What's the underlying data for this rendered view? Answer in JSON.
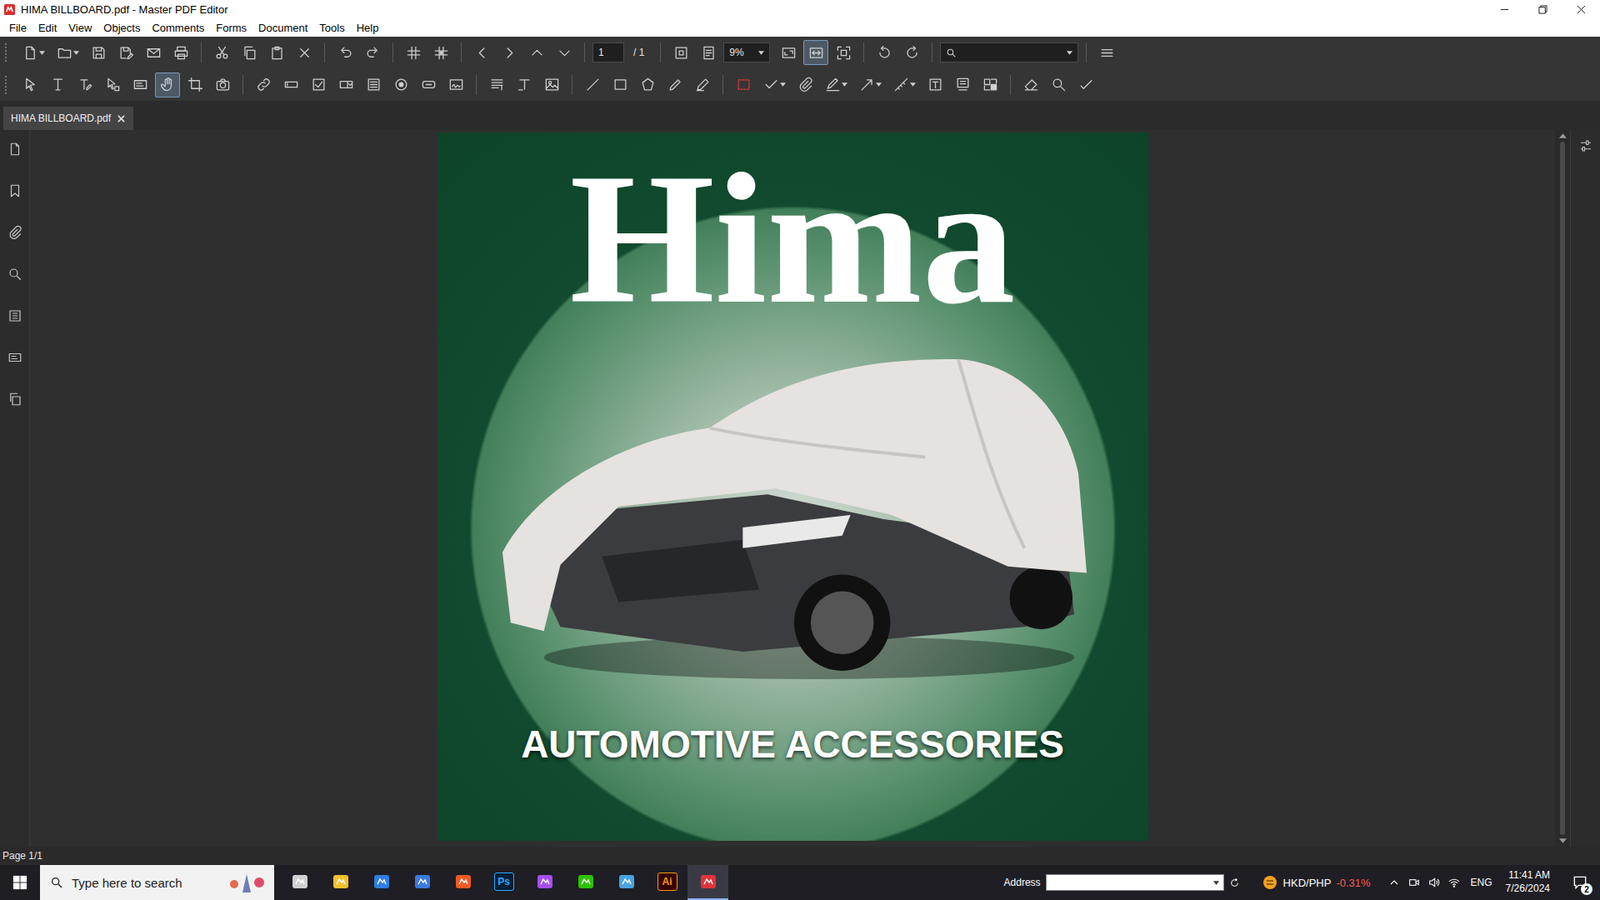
{
  "window": {
    "title": "HIMA BILLBOARD.pdf - Master PDF Editor"
  },
  "menu": [
    "File",
    "Edit",
    "View",
    "Objects",
    "Comments",
    "Forms",
    "Document",
    "Tools",
    "Help"
  ],
  "main_toolbar": {
    "groups": [
      {
        "buttons": [
          {
            "selected": false,
            "dropdown": true
          },
          {
            "selected": false,
            "dropdown": true
          },
          {
            "selected": false,
            "dropdown": false
          },
          {
            "selected": false,
            "dropdown": false
          },
          {
            "selected": false,
            "dropdown": false
          },
          {
            "selected": false,
            "dropdown": false
          }
        ]
      },
      {
        "buttons": [
          {
            "selected": false,
            "dropdown": false
          },
          {
            "selected": false,
            "dropdown": false
          },
          {
            "selected": false,
            "dropdown": false
          },
          {
            "selected": false,
            "dropdown": false
          }
        ]
      },
      {
        "buttons": [
          {
            "selected": false,
            "dropdown": false
          },
          {
            "selected": false,
            "dropdown": false
          }
        ]
      },
      {
        "buttons": [
          {
            "selected": false,
            "dropdown": false
          },
          {
            "selected": false,
            "dropdown": false
          }
        ]
      },
      {
        "buttons": [
          {
            "selected": false,
            "dropdown": false
          },
          {
            "selected": false,
            "dropdown": false
          },
          {
            "selected": false,
            "dropdown": false
          },
          {
            "selected": false,
            "dropdown": false
          }
        ]
      }
    ],
    "page_field": "1",
    "page_total": "/ 1",
    "view_buttons": [
      {
        "selected": false
      },
      {
        "selected": false
      }
    ],
    "zoom": "9%",
    "zoom_buttons": [
      {
        "selected": false
      },
      {
        "selected": true
      },
      {
        "selected": false
      }
    ],
    "rotate_buttons": [
      {
        "selected": false
      },
      {
        "selected": false
      }
    ],
    "menu_button": {
      "selected": false
    }
  },
  "tool_toolbar": {
    "groups": [
      {
        "buttons": [
          {
            "selected": false,
            "dropdown": false
          },
          {
            "selected": false,
            "dropdown": false
          },
          {
            "selected": false,
            "dropdown": false
          },
          {
            "selected": false,
            "dropdown": false
          },
          {
            "selected": false,
            "dropdown": false
          },
          {
            "selected": true,
            "dropdown": false
          },
          {
            "selected": false,
            "dropdown": false
          },
          {
            "selected": false,
            "dropdown": false
          }
        ]
      },
      {
        "buttons": [
          {
            "selected": false,
            "dropdown": false
          },
          {
            "selected": false,
            "dropdown": false
          },
          {
            "selected": false,
            "dropdown": false
          },
          {
            "selected": false,
            "dropdown": false
          },
          {
            "selected": false,
            "dropdown": false
          },
          {
            "selected": false,
            "dropdown": false
          },
          {
            "selected": false,
            "dropdown": false
          },
          {
            "selected": false,
            "dropdown": false
          }
        ]
      },
      {
        "buttons": [
          {
            "selected": false,
            "dropdown": false
          },
          {
            "selected": false,
            "dropdown": false
          },
          {
            "selected": false,
            "dropdown": false
          }
        ]
      },
      {
        "buttons": [
          {
            "selected": false,
            "dropdown": false
          },
          {
            "selected": false,
            "dropdown": false
          },
          {
            "selected": false,
            "dropdown": false
          },
          {
            "selected": false,
            "dropdown": false
          },
          {
            "selected": false,
            "dropdown": false
          }
        ]
      },
      {
        "buttons": [
          {
            "selected": false,
            "dropdown": false
          },
          {
            "selected": false,
            "dropdown": true
          },
          {
            "selected": false,
            "dropdown": false
          },
          {
            "selected": false,
            "dropdown": true
          },
          {
            "selected": false,
            "dropdown": true
          },
          {
            "selected": false,
            "dropdown": true
          },
          {
            "selected": false,
            "dropdown": false
          },
          {
            "selected": false,
            "dropdown": false
          },
          {
            "selected": false,
            "dropdown": false
          }
        ]
      },
      {
        "buttons": [
          {
            "selected": false,
            "dropdown": false
          },
          {
            "selected": false,
            "dropdown": false
          },
          {
            "selected": false,
            "dropdown": false
          }
        ]
      }
    ]
  },
  "tabs": [
    {
      "label": "HIMA BILLBOARD.pdf",
      "selected": true
    }
  ],
  "sidebar": {
    "items": [
      {
        "selected": false
      },
      {
        "selected": false
      },
      {
        "selected": false
      },
      {
        "selected": false
      },
      {
        "selected": false
      },
      {
        "selected": false
      },
      {
        "selected": false
      }
    ]
  },
  "document": {
    "logo": "Hima",
    "tagline": "AUTOMOTIVE ACCESSORIES"
  },
  "status_bar": "Page 1/1",
  "taskbar": {
    "search_placeholder": "Type here to search",
    "apps": [
      {
        "text": "",
        "active": false
      },
      {
        "text": "",
        "active": false
      },
      {
        "text": "",
        "active": false
      },
      {
        "text": "",
        "active": false
      },
      {
        "text": "",
        "active": false
      },
      {
        "text": "Ps",
        "active": false
      },
      {
        "text": "",
        "active": false
      },
      {
        "text": "",
        "active": false
      },
      {
        "text": "",
        "active": false
      },
      {
        "text": "Ai",
        "active": false
      },
      {
        "text": "",
        "active": true
      }
    ],
    "address_label": "Address",
    "ticker_pair": "HKD/PHP",
    "ticker_change": "-0.31%",
    "language": "ENG",
    "time": "11:41 AM",
    "date": "7/26/2024",
    "notifications": "2"
  }
}
